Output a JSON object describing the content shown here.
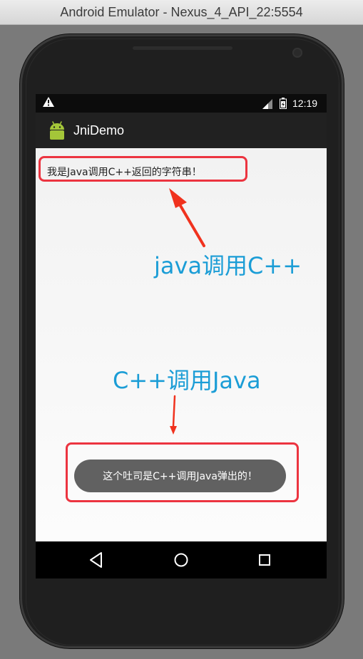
{
  "window": {
    "title": "Android Emulator - Nexus_4_API_22:5554"
  },
  "statusbar": {
    "time": "12:19"
  },
  "appbar": {
    "title": "JniDemo"
  },
  "content": {
    "jni_string": "我是Java调用C++返回的字符串！",
    "toast": "这个吐司是C++调用Java弹出的！"
  },
  "annotations": {
    "java_calls_cpp": "java调用C++",
    "cpp_calls_java": "C++调用Java"
  },
  "colors": {
    "annotation_text": "#1b9dd6",
    "annotation_box": "#ec3440",
    "android_green": "#a4c639"
  }
}
